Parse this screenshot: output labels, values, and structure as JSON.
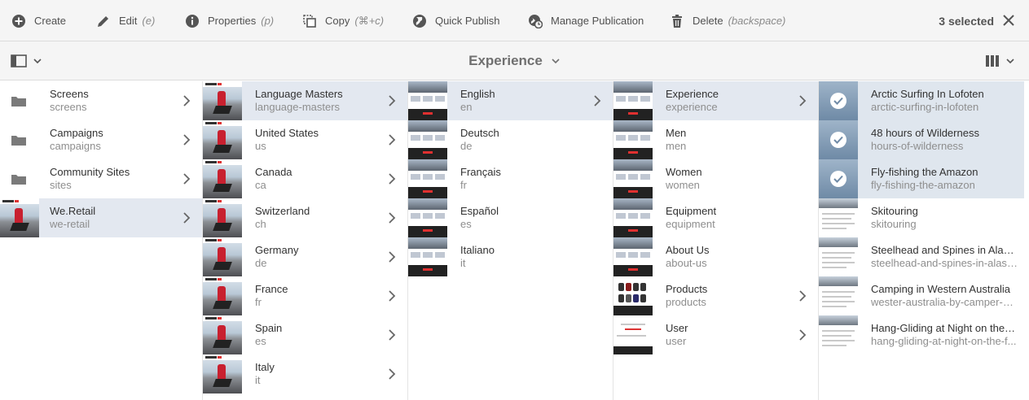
{
  "actionbar": {
    "create": "Create",
    "edit": "Edit",
    "edit_key": "(e)",
    "properties": "Properties",
    "properties_key": "(p)",
    "copy": "Copy",
    "copy_key": "(⌘+c)",
    "quick_publish": "Quick Publish",
    "manage_publication": "Manage Publication",
    "delete": "Delete",
    "delete_key": "(backspace)",
    "selected": "3 selected"
  },
  "titlebar": {
    "title": "Experience"
  },
  "col1": [
    {
      "title": "Screens",
      "name": "screens",
      "thumb": "folder-icon"
    },
    {
      "title": "Campaigns",
      "name": "campaigns",
      "thumb": "folder-icon"
    },
    {
      "title": "Community Sites",
      "name": "sites",
      "thumb": "folder-icon"
    },
    {
      "title": "We.Retail",
      "name": "we-retail",
      "thumb": "photo"
    }
  ],
  "col2": [
    {
      "title": "Language Masters",
      "name": "language-masters"
    },
    {
      "title": "United States",
      "name": "us"
    },
    {
      "title": "Canada",
      "name": "ca"
    },
    {
      "title": "Switzerland",
      "name": "ch"
    },
    {
      "title": "Germany",
      "name": "de"
    },
    {
      "title": "France",
      "name": "fr"
    },
    {
      "title": "Spain",
      "name": "es"
    },
    {
      "title": "Italy",
      "name": "it"
    }
  ],
  "col3": [
    {
      "title": "English",
      "name": "en"
    },
    {
      "title": "Deutsch",
      "name": "de"
    },
    {
      "title": "Français",
      "name": "fr"
    },
    {
      "title": "Español",
      "name": "es"
    },
    {
      "title": "Italiano",
      "name": "it"
    }
  ],
  "col4": [
    {
      "title": "Experience",
      "name": "experience"
    },
    {
      "title": "Men",
      "name": "men"
    },
    {
      "title": "Women",
      "name": "women"
    },
    {
      "title": "Equipment",
      "name": "equipment"
    },
    {
      "title": "About Us",
      "name": "about-us"
    },
    {
      "title": "Products",
      "name": "products"
    },
    {
      "title": "User",
      "name": "user"
    }
  ],
  "col5": [
    {
      "title": "Arctic Surfing In Lofoten",
      "name": "arctic-surfing-in-lofoten",
      "selected": true
    },
    {
      "title": "48 hours of Wilderness",
      "name": "hours-of-wilderness",
      "selected": true
    },
    {
      "title": "Fly-fishing the Amazon",
      "name": "fly-fishing-the-amazon",
      "selected": true
    },
    {
      "title": "Skitouring",
      "name": "skitouring",
      "selected": false
    },
    {
      "title": "Steelhead and Spines in Alaska",
      "name": "steelhead-and-spines-in-alaska",
      "selected": false
    },
    {
      "title": "Camping in Western Australia",
      "name": "wester-australia-by-camper-van",
      "selected": false
    },
    {
      "title": "Hang-Gliding at Night on the F...",
      "name": "hang-gliding-at-night-on-the-f...",
      "selected": false
    }
  ],
  "colors": {
    "bar_bg": "#f5f5f5",
    "active_row": "#e3e8f0",
    "selected_row": "#dfe6ee",
    "border": "#dcdcdc"
  }
}
